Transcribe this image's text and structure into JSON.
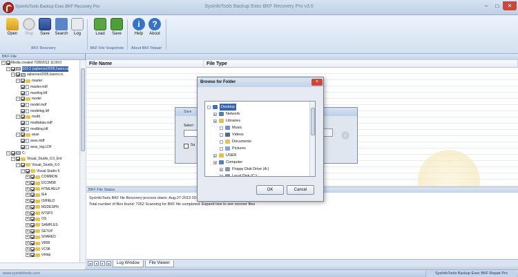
{
  "window": {
    "app_name": "SysInfoTools Backup Exec BKF Recovery Pro",
    "title": "SysInfoTools Backup Exec BKF Recovery Pro v3.0"
  },
  "toolbar": {
    "groups": [
      {
        "label": "BKF Recovery",
        "buttons": [
          {
            "label": "Open",
            "icon": "open-folder-icon",
            "enabled": true
          },
          {
            "label": "Stop",
            "icon": "stop-icon",
            "enabled": false
          },
          {
            "label": "Save",
            "icon": "save-icon",
            "enabled": true
          },
          {
            "label": "Search",
            "icon": "search-icon",
            "enabled": true
          },
          {
            "label": "Log",
            "icon": "log-icon",
            "enabled": true
          }
        ]
      },
      {
        "label": "BKF File Snapshots",
        "buttons": [
          {
            "label": "Load",
            "icon": "load-icon",
            "enabled": true
          },
          {
            "label": "Save",
            "icon": "save-snapshot-icon",
            "enabled": true
          }
        ]
      },
      {
        "label": "About BKF Repair",
        "buttons": [
          {
            "label": "Help",
            "icon": "help-icon",
            "enabled": true
          },
          {
            "label": "About",
            "icon": "about-icon",
            "enabled": true
          }
        ]
      }
    ]
  },
  "left_panel": {
    "header": "BKF File",
    "tree": [
      "Media created 7/28/2013 11:00:0",
      "S03 2 (sqlserver2005,\\\\serv.co",
      "sqlserver2005,Isserv.co",
      "master",
      "master.mdf",
      "mastlog.ldf",
      "model",
      "model.mdf",
      "modellog.ldf",
      "msdb",
      "msdbdata.mdf",
      "msdblog.ldf",
      "axas",
      "axas.mdf",
      "axas_log.LDF",
      "C:",
      "Visual_Studio_6.0_Ent",
      "Visual_Studio_6.0",
      "Visual Studio 6",
      "COMMON",
      "DCOM98",
      "HTMLHELP",
      "IE4",
      "ISHIELD",
      "MSDESPN",
      "NTSP3",
      "OS",
      "SAMPLES",
      "SETUP",
      "SHARED",
      "VB98",
      "VC98",
      "vintap"
    ]
  },
  "main_panel": {
    "columns": [
      "File Name",
      "File Type"
    ]
  },
  "status_panel": {
    "header": "BKF File Status",
    "lines": [
      "SysInfoTools BKF file Recovery process starts.  Aug-27-2013 03:44 PM",
      "Total number of files found: 7262 Scanning for BKF file completed.  Expand tree to see recover files"
    ]
  },
  "bottom_tabs": [
    "Log Window",
    "File Viewer"
  ],
  "status_bar": {
    "left": "www.sysinfotools.com",
    "right": "SysInfoTools Backup Exec BKF Repair Pro"
  },
  "behind_dialog": {
    "title": "Save",
    "select_label": "Select",
    "checkbox_label": "Sa"
  },
  "browse_dialog": {
    "title": "Browse for Folder",
    "close": "×",
    "items": [
      {
        "label": "Desktop",
        "icon": "desktop-icon",
        "selected": true
      },
      {
        "label": "Network",
        "icon": "network-icon"
      },
      {
        "label": "Libraries",
        "icon": "libraries-icon"
      },
      {
        "label": "Music",
        "icon": "music-icon"
      },
      {
        "label": "Videos",
        "icon": "videos-icon"
      },
      {
        "label": "Documents",
        "icon": "documents-icon"
      },
      {
        "label": "Pictures",
        "icon": "pictures-icon"
      },
      {
        "label": "USER",
        "icon": "user-folder-icon"
      },
      {
        "label": "Computer",
        "icon": "computer-icon"
      },
      {
        "label": "Floppy Disk Drive (A:)",
        "icon": "floppy-icon"
      },
      {
        "label": "Local Disk (C:)",
        "icon": "local-disk-icon"
      }
    ],
    "ok": "OK",
    "cancel": "Cancel"
  },
  "colors": {
    "accent": "#3a62a8",
    "frame": "#c9d7e8",
    "close": "#c9483a"
  }
}
